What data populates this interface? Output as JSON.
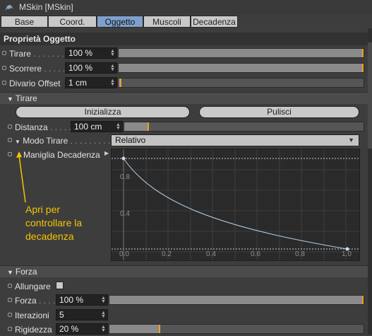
{
  "window": {
    "title": "MSkin [MSkin]"
  },
  "tabs": [
    {
      "label": "Base",
      "active": false
    },
    {
      "label": "Coord.",
      "active": false
    },
    {
      "label": "Oggetto",
      "active": true
    },
    {
      "label": "Muscoli",
      "active": false
    },
    {
      "label": "Decadenza",
      "active": false
    }
  ],
  "section": {
    "title": "Proprietà Oggetto"
  },
  "props": {
    "tirare": {
      "label": "Tirare",
      "dots": " . . . . . . .",
      "value": "100 %",
      "slider_level": 1.0
    },
    "scorrere": {
      "label": "Scorrere",
      "dots": " . . . . .",
      "value": "100 %",
      "slider_level": 1.0
    },
    "divario": {
      "label": "Divario Offset",
      "value": "1 cm",
      "slider_level": 0.01
    }
  },
  "tirare_group": {
    "header": "Tirare",
    "btn_init": "Inizializza",
    "btn_clear": "Pulisci",
    "distanza": {
      "label": "Distanza",
      "dots": " . . . . .",
      "value": "100 cm",
      "slider_level": 0.1
    },
    "modo": {
      "label": "Modo Tirare",
      "dots": " . . . . . . . . .",
      "value": "Relativo"
    },
    "maniglia": {
      "label": "Maniglia Decadenza"
    }
  },
  "graph": {
    "y_ticks": [
      "0.8",
      "0.4"
    ],
    "x_ticks": [
      "0.0",
      "0.2",
      "0.4",
      "0.6",
      "0.8",
      "1.0"
    ],
    "curve_color": "#b8d4ee",
    "grid_color": "#3e3e3e"
  },
  "annotation": {
    "lines": [
      "Apri per",
      "controllare la",
      "decadenza"
    ],
    "color": "#f5c400"
  },
  "forza_group": {
    "header": "Forza",
    "allungare": {
      "label": "Allungare",
      "checked": false
    },
    "forza": {
      "label": "Forza",
      "dots": " . . . . .",
      "value": "100 %",
      "slider_level": 1.0
    },
    "iterazioni": {
      "label": "Iterazioni",
      "value": "5"
    },
    "rigidezza": {
      "label": "Rigidezza",
      "value": "20 %",
      "slider_level": 0.2
    }
  }
}
